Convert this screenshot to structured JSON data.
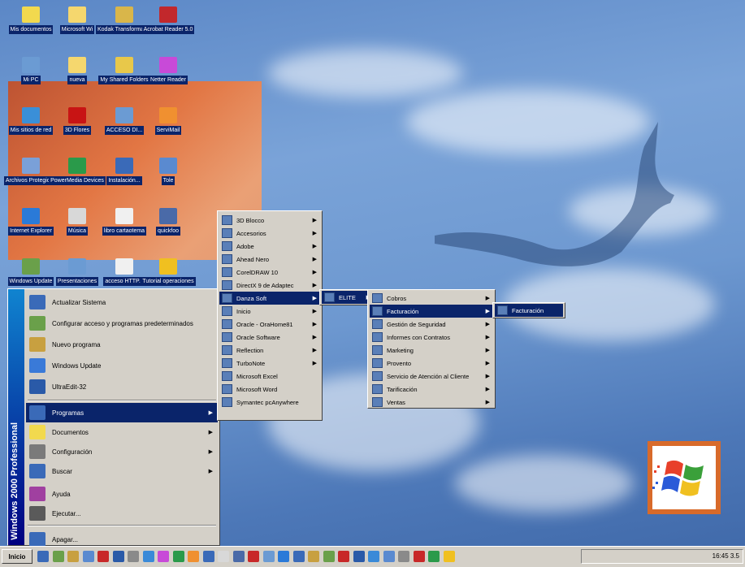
{
  "desktop_icons": [
    {
      "label": "Mis documentos",
      "color": "#f2d94e"
    },
    {
      "label": "Microsoft Wi",
      "color": "#f5d76e"
    },
    {
      "label": "Kodak Transformations",
      "color": "#d9b64a"
    },
    {
      "label": "Acrobat Reader 5.0",
      "color": "#c2282c"
    },
    {
      "label": "Mi PC",
      "color": "#6b9bd3"
    },
    {
      "label": "nueva",
      "color": "#f5d76e"
    },
    {
      "label": "My Shared Folders",
      "color": "#e8c84a"
    },
    {
      "label": "Netter Reader",
      "color": "#c84ad8"
    },
    {
      "label": "Mis sitios de red",
      "color": "#3a8fd8"
    },
    {
      "label": "3D Flores",
      "color": "#c81414"
    },
    {
      "label": "ACCESO DI...",
      "color": "#6b9bd3"
    },
    {
      "label": "ServiMail",
      "color": "#f09030"
    },
    {
      "label": "Archivos Protegidos",
      "color": "#7aa0d8"
    },
    {
      "label": "PowerMedia Devices",
      "color": "#2a9a4a"
    },
    {
      "label": "Instalación...",
      "color": "#3a6ab8"
    },
    {
      "label": "Tole",
      "color": "#5a8ad0"
    },
    {
      "label": "Internet Explorer",
      "color": "#2a7ad8"
    },
    {
      "label": "Música",
      "color": "#d8d8d8"
    },
    {
      "label": "libro cartaotema",
      "color": "#f0f0f0"
    },
    {
      "label": "quickfoo",
      "color": "#4a6aa8"
    },
    {
      "label": "Windows Update",
      "color": "#6aa04a"
    },
    {
      "label": "Presentaciones",
      "color": "#6b9bd3"
    },
    {
      "label": "acceso HTTP...",
      "color": "#f0f0f0"
    },
    {
      "label": "Tutorial operaciones",
      "color": "#f0c020"
    }
  ],
  "start_menu": {
    "banner": "Windows 2000 Professional",
    "top_items": [
      {
        "label": "Actualizar Sistema",
        "color": "#3a6ab8"
      },
      {
        "label": "Configurar acceso y programas predeterminados",
        "color": "#6aa04a"
      },
      {
        "label": "Nuevo programa",
        "color": "#c8a040"
      },
      {
        "label": "Windows Update",
        "color": "#3a7ad8"
      },
      {
        "label": "UltraEdit-32",
        "color": "#2a5aa8"
      }
    ],
    "items": [
      {
        "label": "Programas",
        "color": "#3a6ab8",
        "arrow": true,
        "selected": true
      },
      {
        "label": "Documentos",
        "color": "#f2d94e",
        "arrow": true
      },
      {
        "label": "Configuración",
        "color": "#7a7a7a",
        "arrow": true
      },
      {
        "label": "Buscar",
        "color": "#3a6ab8",
        "arrow": true
      },
      {
        "label": "Ayuda",
        "color": "#a040a0",
        "arrow": false
      },
      {
        "label": "Ejecutar...",
        "color": "#5a5a5a",
        "arrow": false
      },
      {
        "label": "Apagar...",
        "color": "#3a6ab8",
        "arrow": false
      }
    ]
  },
  "programs_menu": [
    {
      "label": "3D Blocco",
      "arrow": true
    },
    {
      "label": "Accesorios",
      "arrow": true
    },
    {
      "label": "Adobe",
      "arrow": true
    },
    {
      "label": "Ahead Nero",
      "arrow": true
    },
    {
      "label": "CorelDRAW 10",
      "arrow": true
    },
    {
      "label": "DirectX 9 de Adaptec",
      "arrow": true
    },
    {
      "label": "Danza Soft",
      "arrow": true,
      "selected": true
    },
    {
      "label": "Inicio",
      "arrow": true
    },
    {
      "label": "Oracle - OraHome81",
      "arrow": true
    },
    {
      "label": "Oracle Software",
      "arrow": true
    },
    {
      "label": "Reflection",
      "arrow": true
    },
    {
      "label": "TurboNote",
      "arrow": true
    },
    {
      "label": "Microsoft Excel",
      "arrow": false
    },
    {
      "label": "Microsoft Word",
      "arrow": false
    },
    {
      "label": "Symantec pcAnywhere",
      "arrow": false
    }
  ],
  "elite_menu": [
    {
      "label": "ELITE",
      "arrow": true,
      "selected": true
    }
  ],
  "elite_sub_menu": [
    {
      "label": "Cobros",
      "arrow": true
    },
    {
      "label": "Facturación",
      "arrow": true,
      "selected": true
    },
    {
      "label": "Gestión de Seguridad",
      "arrow": true
    },
    {
      "label": "Informes con Contratos",
      "arrow": true
    },
    {
      "label": "Marketing",
      "arrow": true
    },
    {
      "label": "Provento",
      "arrow": true
    },
    {
      "label": "Servicio de Atención al Cliente",
      "arrow": true
    },
    {
      "label": "Tarificación",
      "arrow": true
    },
    {
      "label": "Ventas",
      "arrow": true
    }
  ],
  "facturacion_menu": [
    {
      "label": "Facturación",
      "selected": true
    }
  ],
  "taskbar": {
    "start_label": "Inicio",
    "clock": "16:45 3.5"
  }
}
